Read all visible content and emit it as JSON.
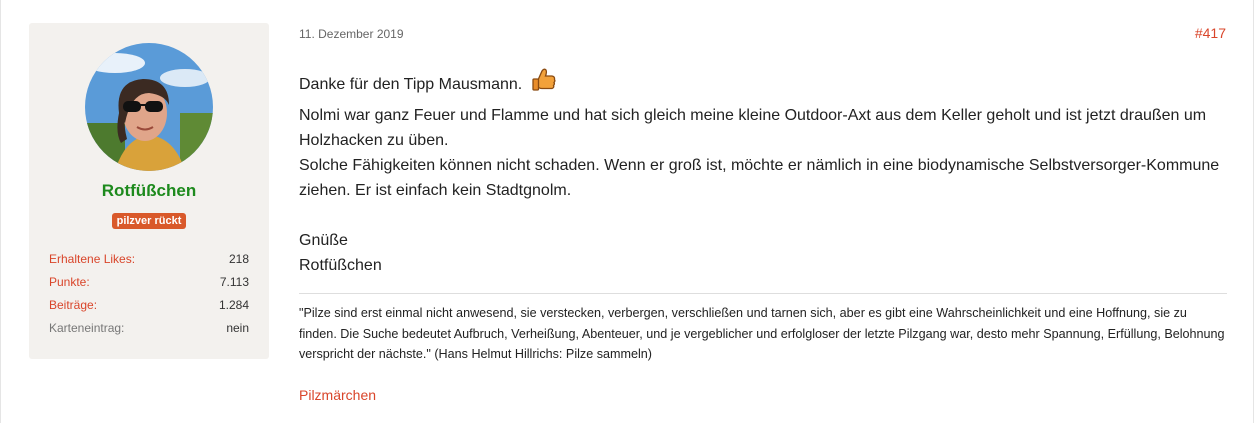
{
  "author": {
    "name": "Rotfüßchen",
    "title_badge": "pilzver rückt",
    "stats": [
      {
        "label": "Erhaltene Likes:",
        "value": "218"
      },
      {
        "label": "Punkte:",
        "value": "7.113"
      },
      {
        "label": "Beiträge:",
        "value": "1.284"
      },
      {
        "label": "Karteneintrag:",
        "value": "nein"
      }
    ]
  },
  "post": {
    "date": "11. Dezember 2019",
    "number": "#417",
    "line1": "Danke für den Tipp Mausmann.",
    "line1_icon": "thumbs-up-icon",
    "line2": "Nolmi war ganz Feuer und Flamme und hat sich gleich meine kleine Outdoor-Axt aus dem Keller geholt und ist jetzt draußen um Holzhacken zu üben.",
    "line3": "Solche Fähigkeiten können nicht schaden. Wenn er groß ist, möchte er nämlich in eine biodynamische Selbstversorger-Kommune ziehen. Er ist einfach kein Stadtgnolm.",
    "greeting": "Gnüße",
    "signoff": "Rotfüßchen"
  },
  "signature": {
    "quote": "\"Pilze sind erst einmal nicht anwesend, sie verstecken, verbergen, verschließen und tarnen sich, aber es gibt eine Wahrscheinlichkeit und eine Hoffnung, sie zu finden. Die Suche bedeutet Aufbruch, Verheißung, Abenteuer, und je vergeblicher und erfolgloser der letzte Pilzgang war, desto mehr Spannung, Erfüllung, Belohnung verspricht der nächste.\" (Hans Helmut Hillrichs: Pilze sammeln)",
    "link": "Pilzmärchen"
  },
  "colors": {
    "accent": "#d9452a",
    "username": "#1d8a1d",
    "badge": "#d9592a",
    "panel_bg": "#f3f1ee"
  }
}
